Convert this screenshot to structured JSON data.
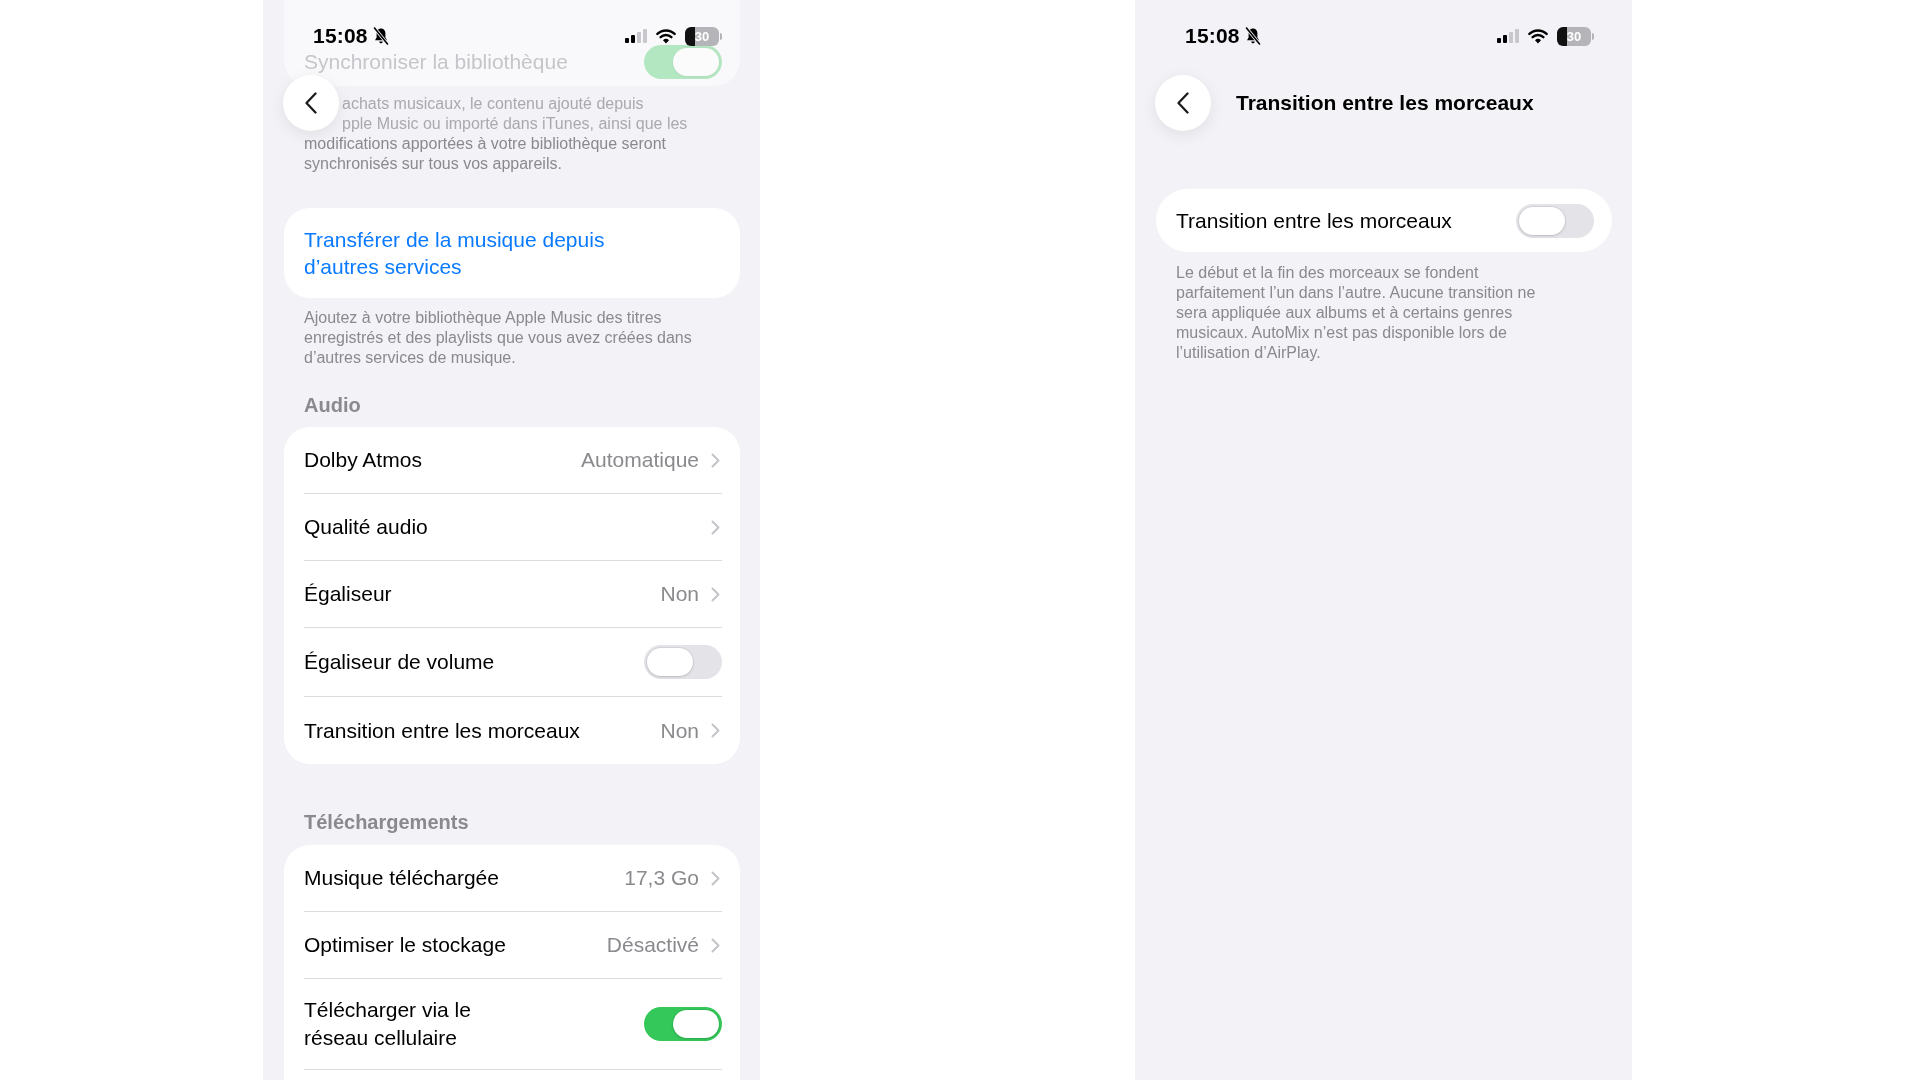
{
  "library_screen": {
    "status_bar": {
      "time": "15:08",
      "battery": "30"
    },
    "sync_row": {
      "label": "Synchroniser la bibliothèque",
      "on": true
    },
    "sync_description_lines": [
      "achats musicaux, le contenu ajouté depuis",
      "pple Music ou importé dans iTunes, ainsi que les",
      "modifications apportées à votre bibliothèque seront",
      "synchronisés sur tous vos appareils."
    ],
    "transfer_link": "Transférer de la musique depuis d’autres services",
    "transfer_footer": "Ajoutez à votre bibliothèque Apple Music des titres enregistrés et des playlists que vous avez créées dans d’autres services de musique.",
    "sections": [
      {
        "header": "Audio",
        "rows": [
          {
            "kind": "link",
            "label": "Dolby Atmos",
            "value": "Automatique"
          },
          {
            "kind": "link",
            "label": "Qualité audio"
          },
          {
            "kind": "link",
            "label": "Égaliseur",
            "value": "Non"
          },
          {
            "kind": "toggle",
            "label": "Égaliseur de volume",
            "on": false
          },
          {
            "kind": "link",
            "label": "Transition entre les morceaux",
            "value": "Non"
          }
        ]
      },
      {
        "header": "Téléchargements",
        "rows": [
          {
            "kind": "link",
            "label": "Musique téléchargée",
            "value": "17,3 Go"
          },
          {
            "kind": "link",
            "label": "Optimiser le stockage",
            "value": "Désactivé"
          },
          {
            "kind": "toggle",
            "label": "Télécharger via le réseau cellulaire",
            "on": true
          }
        ]
      }
    ]
  },
  "transition_screen": {
    "status_bar": {
      "time": "15:08",
      "battery": "30"
    },
    "title": "Transition entre les morceaux",
    "toggle_row": {
      "label": "Transition entre les morceaux",
      "on": false
    },
    "description": "Le début et la fin des morceaux se fondent parfaitement l’un dans l’autre. Aucune transition ne sera appliquée aux albums et à certains genres musicaux. AutoMix n’est pas disponible lors de l’utilisation d’AirPlay."
  }
}
